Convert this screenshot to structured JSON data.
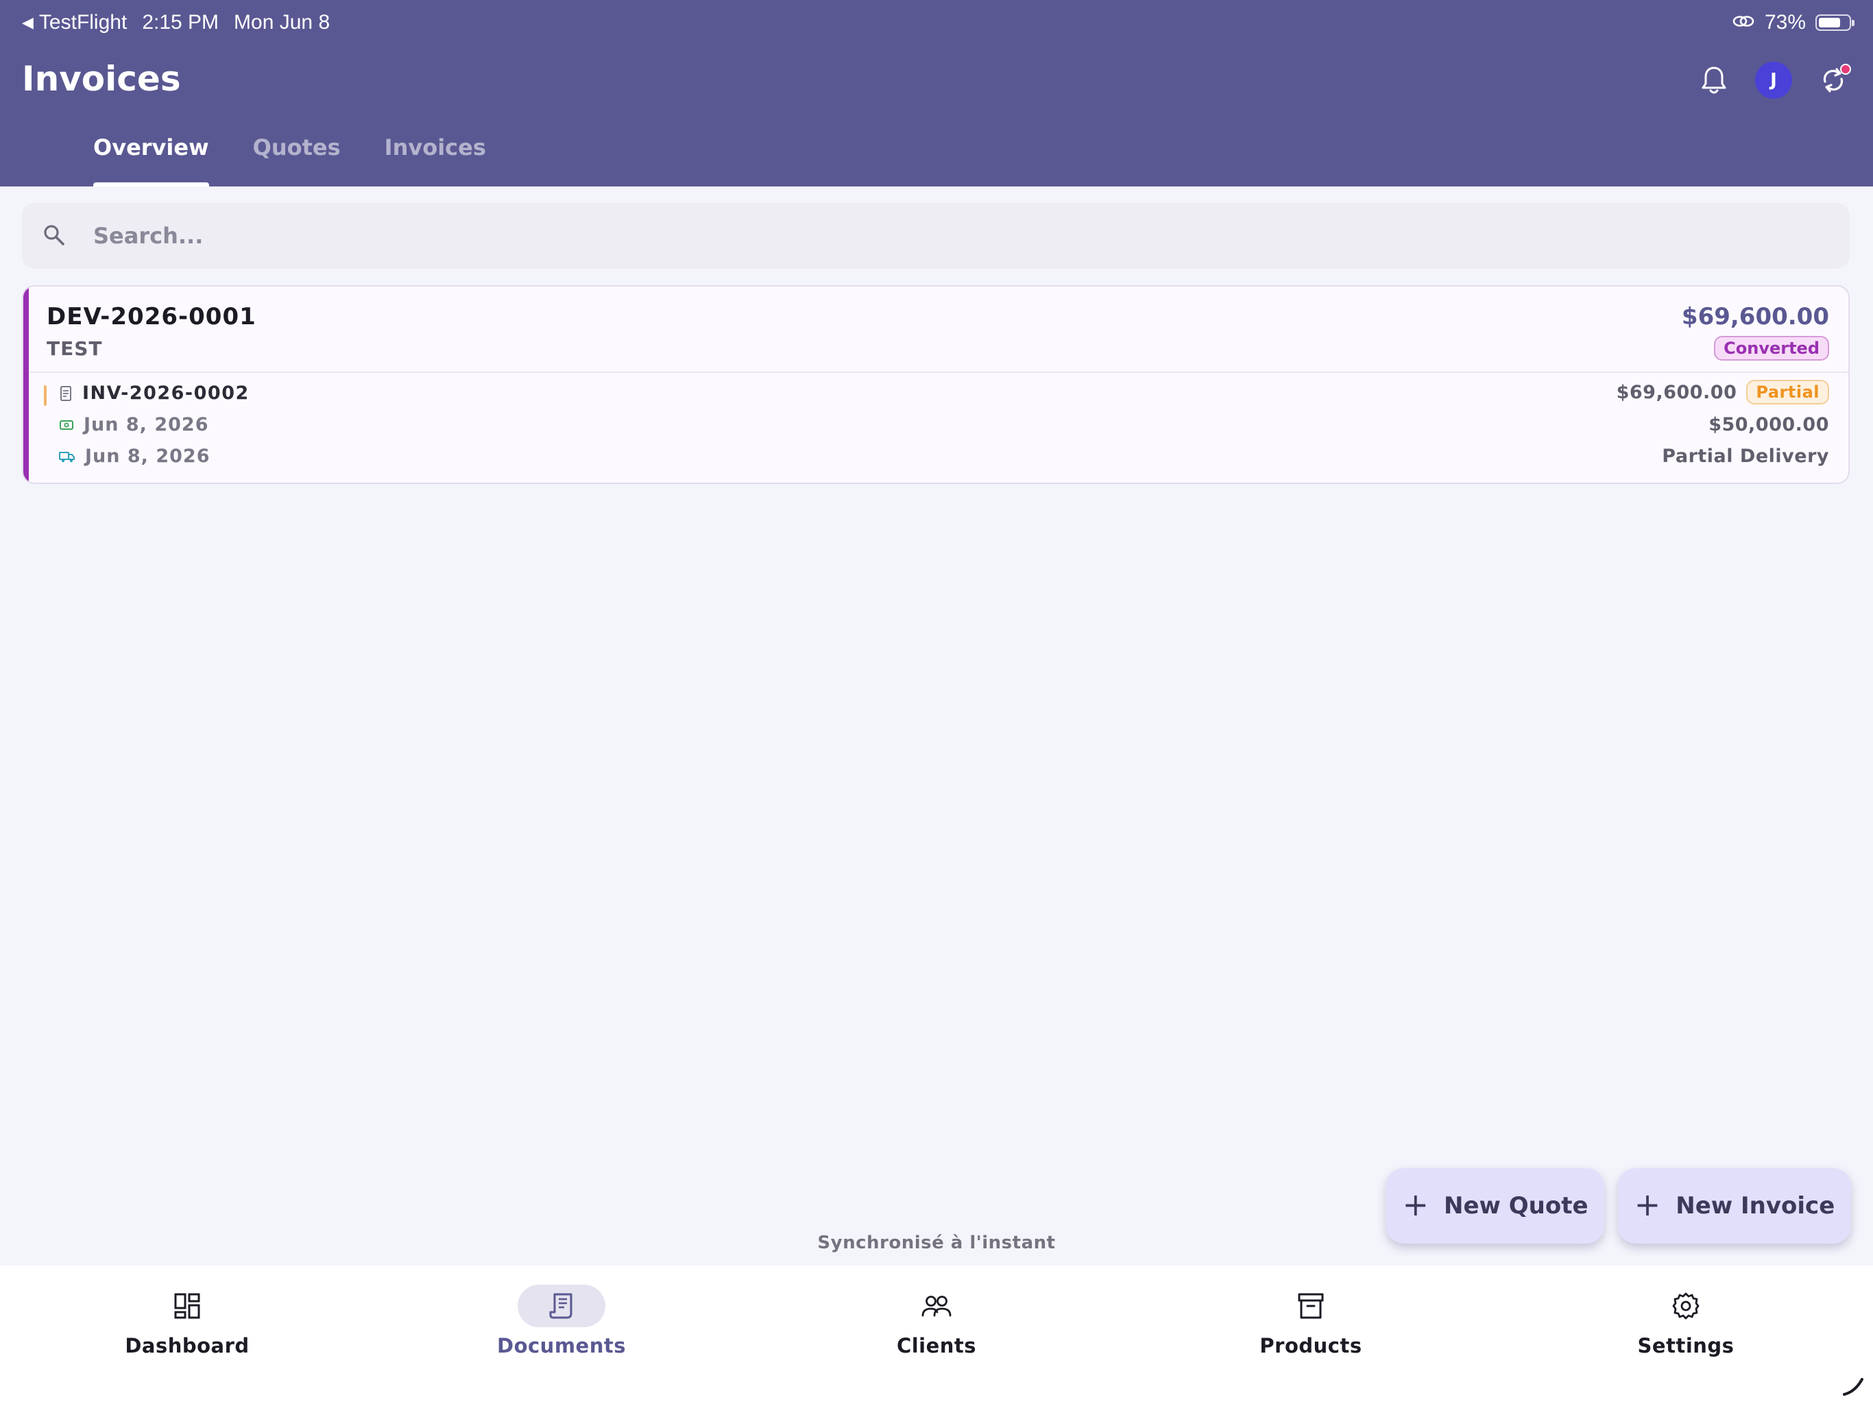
{
  "status_bar": {
    "back_app": "TestFlight",
    "time": "2:15 PM",
    "date": "Mon Jun 8",
    "battery": "73%",
    "battery_level": 0.73
  },
  "header": {
    "title": "Invoices",
    "avatar_initial": "J",
    "icons": [
      "bell-icon",
      "avatar",
      "sync-icon"
    ]
  },
  "tabs": [
    {
      "label": "Overview",
      "active": true
    },
    {
      "label": "Quotes",
      "active": false
    },
    {
      "label": "Invoices",
      "active": false
    }
  ],
  "search": {
    "placeholder": "Search...",
    "value": ""
  },
  "quote_card": {
    "number": "DEV-2026-0001",
    "client": "TEST",
    "amount": "$69,600.00",
    "status": "Converted",
    "invoice": {
      "number": "INV-2026-0002",
      "amount": "$69,600.00",
      "status": "Partial",
      "payment_date": "Jun 8, 2026",
      "paid_amount": "$50,000.00",
      "delivery_date": "Jun 8, 2026",
      "delivery_status": "Partial Delivery"
    }
  },
  "sync_status": "Synchronisé à l'instant",
  "fab": {
    "new_quote": "New Quote",
    "new_invoice": "New Invoice"
  },
  "bottom_nav": [
    {
      "label": "Dashboard",
      "icon": "dashboard-icon",
      "active": false
    },
    {
      "label": "Documents",
      "icon": "documents-icon",
      "active": true
    },
    {
      "label": "Clients",
      "icon": "clients-icon",
      "active": false
    },
    {
      "label": "Products",
      "icon": "products-icon",
      "active": false
    },
    {
      "label": "Settings",
      "icon": "settings-icon",
      "active": false
    }
  ],
  "colors": {
    "header": "#5a5892",
    "accent_quote": "#9a2fb2",
    "partial": "#ef9320",
    "fab": "#e2dffb",
    "avatar": "#4a41d9"
  }
}
